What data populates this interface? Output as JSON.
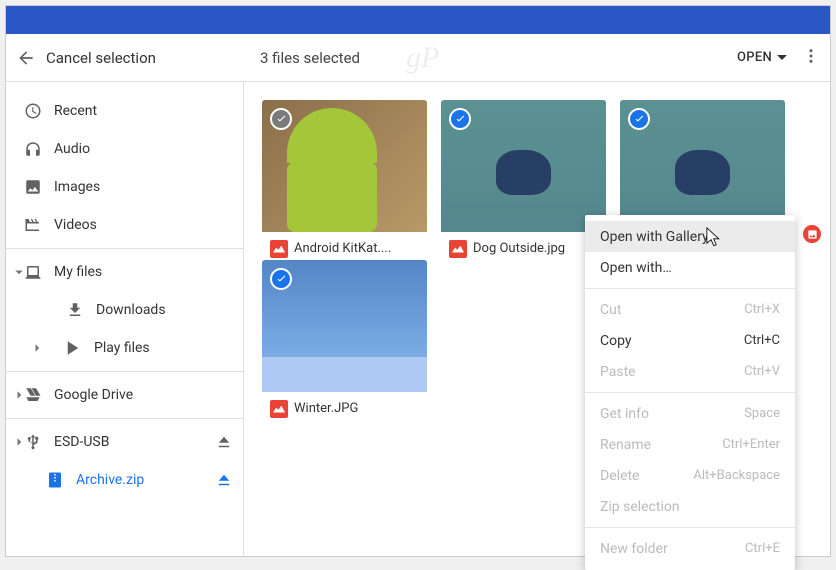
{
  "toolbar": {
    "cancel_label": "Cancel selection",
    "selection_text": "3 files selected",
    "open_label": "OPEN"
  },
  "sidebar": {
    "recent": "Recent",
    "audio": "Audio",
    "images": "Images",
    "videos": "Videos",
    "myfiles": "My files",
    "downloads": "Downloads",
    "playfiles": "Play files",
    "gdrive": "Google Drive",
    "esdusb": "ESD-USB",
    "archive": "Archive.zip"
  },
  "files": {
    "f1": "Android KitKat....",
    "f2": "Dog Outside.jpg",
    "f3": "",
    "f4": "Winter.JPG"
  },
  "context_menu": {
    "open_gallery": "Open with Gallery",
    "open_with": "Open with…",
    "cut": "Cut",
    "cut_key": "Ctrl+X",
    "copy": "Copy",
    "copy_key": "Ctrl+C",
    "paste": "Paste",
    "paste_key": "Ctrl+V",
    "getinfo": "Get info",
    "getinfo_key": "Space",
    "rename": "Rename",
    "rename_key": "Ctrl+Enter",
    "delete": "Delete",
    "delete_key": "Alt+Backspace",
    "zip": "Zip selection",
    "newfolder": "New folder",
    "newfolder_key": "Ctrl+E"
  }
}
